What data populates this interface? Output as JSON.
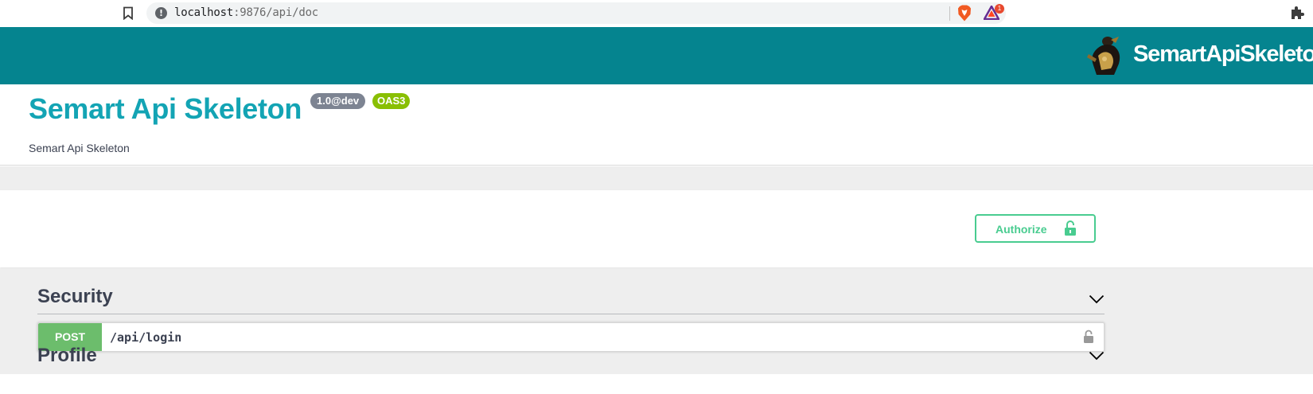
{
  "browser": {
    "url_host": "localhost",
    "url_rest": ":9876/api/doc",
    "rewards_badge": "1",
    "icons": [
      "bookmark-icon",
      "site-info-icon",
      "brave-shield-icon",
      "brave-rewards-icon",
      "extensions-icon"
    ]
  },
  "topbar": {
    "logo_text": "SemartApiSkeleton",
    "background": "#05848f"
  },
  "info": {
    "title": "Semart Api Skeleton",
    "version": "1.0@dev",
    "oas": "OAS3",
    "description": "Semart Api Skeleton",
    "title_color": "#13a4b4"
  },
  "scheme": {
    "authorize_label": "Authorize",
    "accent": "#49cc90"
  },
  "tags": [
    {
      "name": "Security",
      "operations": [
        {
          "method": "POST",
          "path": "/api/login",
          "method_color": "#6cbd6c"
        }
      ]
    },
    {
      "name": "Profile",
      "operations": []
    }
  ]
}
